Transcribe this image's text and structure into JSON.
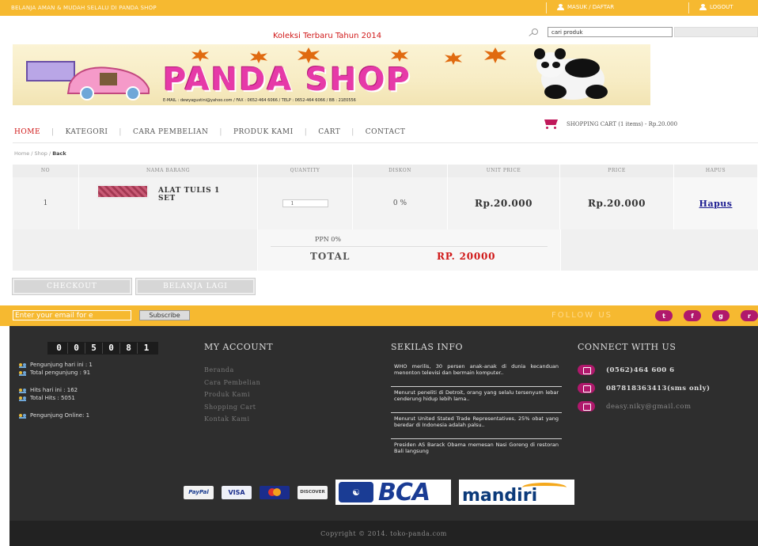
{
  "topbar": {
    "welcome": "BELANJA AMAN & MUDAH SELALU DI PANDA SHOP",
    "link1": "MASUK / DAFTAR",
    "link2": "LOGOUT"
  },
  "header": {
    "tagline": "Koleksi Terbaru Tahun 2014",
    "search_placeholder": "cari produk",
    "logo_text": "PANDA SHOP",
    "contact_line": "E-MAIL : dewyagustini@yahoo.com / FAX : 0652-464 6066 / TELP : 0652-464 6066 / BB : 21E0556"
  },
  "nav": {
    "items": [
      "HOME",
      "KATEGORI",
      "CARA PEMBELIAN",
      "PRODUK KAMI",
      "CART",
      "CONTACT"
    ],
    "cart_info": "SHOPPING CART (1 items) - Rp.20.000"
  },
  "breadcrumb": {
    "home": "Home",
    "shop": "Shop",
    "current": "Back"
  },
  "cart_table": {
    "headers": [
      "NO",
      "NAMA BARANG",
      "QUANTITY",
      "DISKON",
      "UNIT PRICE",
      "PRICE",
      "HAPUS"
    ],
    "rows": [
      {
        "no": "1",
        "name": "ALAT TULIS 1 SET",
        "qty": "1",
        "discount": "0 %",
        "unit_price": "Rp.20.000",
        "price": "Rp.20.000",
        "delete": "Hapus"
      }
    ],
    "ppn": "PPN 0%",
    "total_label": "TOTAL",
    "total_value": "RP. 20000"
  },
  "buttons": {
    "checkout": "CHECKOUT",
    "continue": "BELANJA LAGI"
  },
  "subscribe": {
    "placeholder": "Enter your email for e",
    "button": "Subscribe",
    "follow": "FOLLOW US"
  },
  "social_icons": [
    "twitter-icon",
    "facebook-icon",
    "googleplus-icon",
    "rss-icon"
  ],
  "footer": {
    "counter_digits": [
      "0",
      "0",
      "5",
      "0",
      "8",
      "1"
    ],
    "stats": {
      "visitors_today": "Pengunjung hari ini : 1",
      "visitors_total": "Total pengunjung : 91",
      "hits_today": "Hits hari ini : 162",
      "hits_total": "Total Hits : 5051",
      "online": "Pengunjung Online: 1"
    },
    "my_account": {
      "title": "MY ACCOUNT",
      "links": [
        "Beranda",
        "Cara Pembelian",
        "Produk Kami",
        "Shopping Cart",
        "Kontak Kami"
      ]
    },
    "sekilas_info": {
      "title": "SEKILAS INFO",
      "items": [
        "WHO merilis, 30 persen anak-anak di dunia kecanduan menonton televisi dan bermain komputer..",
        "Menurut peneliti di Detroit, orang yang selalu tersenyum lebar cenderung hidup lebih lama..",
        "Menurut United Stated Trade Representatives, 25% obat yang beredar di Indonesia adalah palsu..",
        "Presiden AS Barack Obama memesan Nasi Goreng di restoran Bali langsung"
      ]
    },
    "connect": {
      "title": "CONNECT WITH US",
      "phone": "(0562)464 600 6",
      "mobile": "087818363413(sms only)",
      "email": "deasy.niky@gmail.com"
    },
    "payment_names": [
      "PayPal",
      "VISA",
      "MasterCard",
      "DISCOVER",
      "BCA",
      "mandiri"
    ],
    "copyright": "Copyright © 2014. toko-panda.com"
  }
}
